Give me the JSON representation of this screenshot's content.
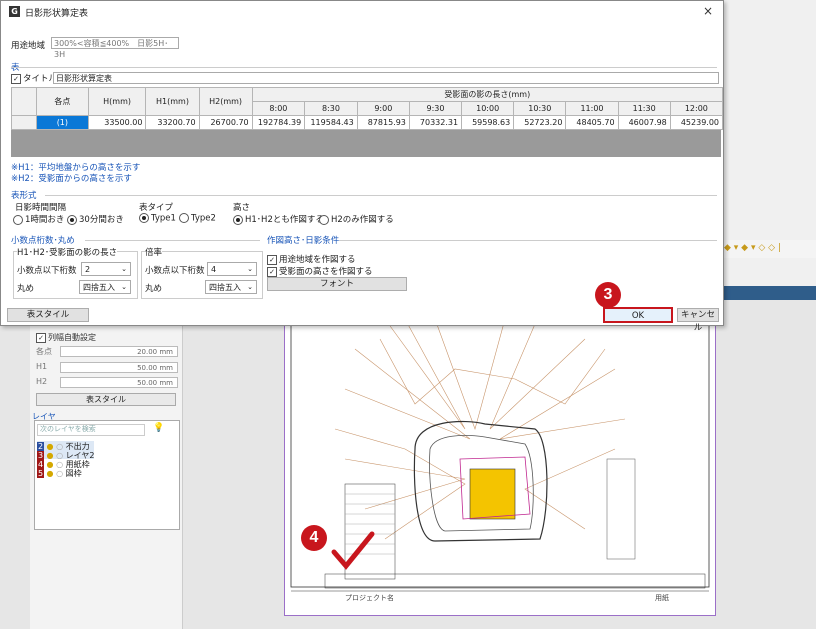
{
  "dialog": {
    "app_icon": "G",
    "title": "日影形状算定表",
    "close": "×",
    "usage": {
      "label": "用途地域",
      "value": "300%<容積≦400%　日影5H･3H"
    },
    "table_section": "表",
    "title_check": {
      "label": "タイトル",
      "value": "日影形状算定表"
    },
    "table": {
      "headers": {
        "point": "各点",
        "h": "H(mm)",
        "h1": "H1(mm)",
        "h2": "H2(mm)",
        "shadow_group": "受影面の影の長さ(mm)"
      },
      "times": [
        "8:00",
        "8:30",
        "9:00",
        "9:30",
        "10:00",
        "10:30",
        "11:00",
        "11:30",
        "12:00"
      ],
      "row": {
        "point": "(1)",
        "h": "33500.00",
        "h1": "33200.70",
        "h2": "26700.70",
        "values": [
          "192784.39",
          "119584.43",
          "87815.93",
          "70332.31",
          "59598.63",
          "52723.20",
          "48405.70",
          "46007.98",
          "45239.00"
        ]
      }
    },
    "notes": [
      "※H1：平均地盤からの高さを示す",
      "※H2：受影面からの高さを示す"
    ],
    "format_section": "表形式",
    "interval": {
      "label": "日影時間間隔",
      "opt1": "1時間おき",
      "opt2": "30分間おき",
      "selected": "opt2"
    },
    "table_type": {
      "label": "表タイプ",
      "opt1": "Type1",
      "opt2": "Type2",
      "selected": "opt1"
    },
    "height": {
      "label": "高さ",
      "opt1": "H1･H2とも作図する",
      "opt2": "H2のみ作図する",
      "selected": "opt1"
    },
    "decimal_section": "小数点桁数･丸め",
    "shadow_len_group": {
      "label": "H1･H2･受影面の影の長さ",
      "digits_label": "小数点以下桁数",
      "digits": "2",
      "round_label": "丸め",
      "round": "四捨五入"
    },
    "ratio_group": {
      "label": "倍率",
      "digits_label": "小数点以下桁数",
      "digits": "4",
      "round_label": "丸め",
      "round": "四捨五入"
    },
    "draw_section": "作図高さ･日影条件",
    "draw_opts": [
      "用途地域を作図する",
      "受影面の高さを作図する"
    ],
    "font_button": "フォント",
    "table_style_button": "表スタイル",
    "ok_button": "OK",
    "cancel_button": "キャンセル"
  },
  "left_panel": {
    "auto_width": "列幅自動設定",
    "fields": [
      {
        "label": "各点",
        "value": "20.00 mm"
      },
      {
        "label": "H1",
        "value": "50.00 mm"
      },
      {
        "label": "H2",
        "value": "50.00 mm"
      }
    ],
    "style_button": "表スタイル",
    "layer_section": "レイヤ",
    "search_placeholder": "次のレイヤを検索",
    "layers": [
      {
        "num": "2",
        "name": "不出力"
      },
      {
        "num": "3",
        "name": "レイヤ2"
      },
      {
        "num": "4",
        "name": "用紙枠"
      },
      {
        "num": "5",
        "name": "図枠"
      }
    ]
  },
  "drawing": {
    "project": "プロジェクト名",
    "sheet": "用紙"
  },
  "badges": {
    "step3": "3",
    "step4": "4"
  },
  "colors": {
    "accent": "#c8161d",
    "selection": "#0a78d7",
    "link_blue": "#1a56b8"
  }
}
